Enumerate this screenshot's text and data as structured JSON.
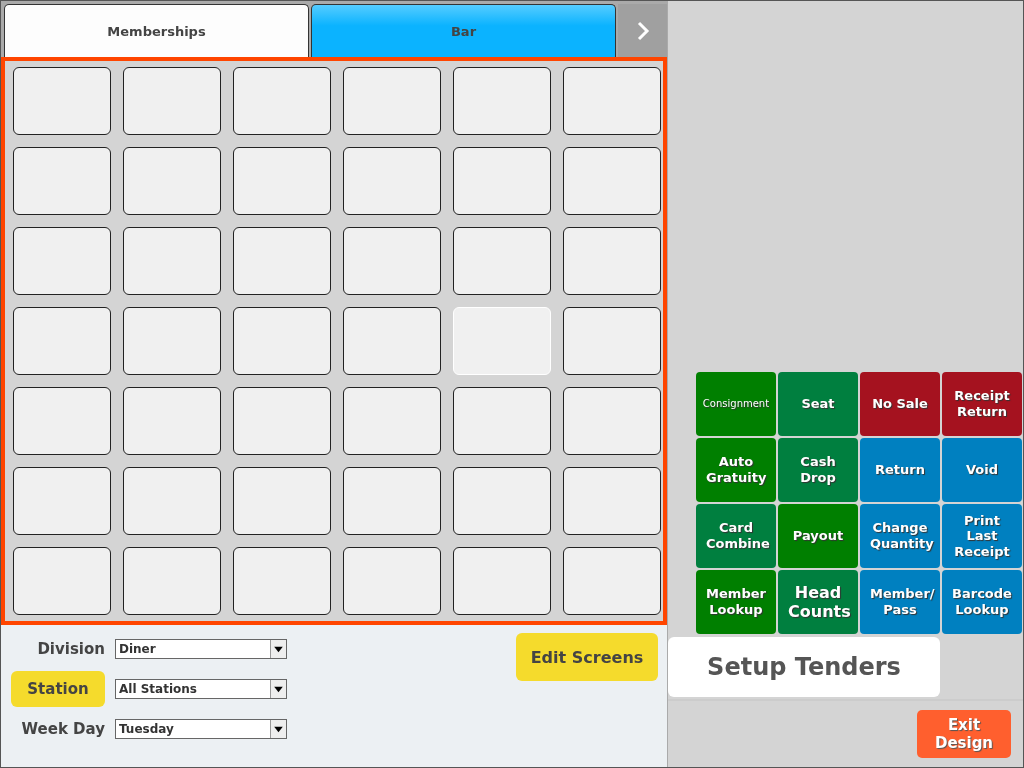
{
  "tabs": [
    {
      "label": "Memberships",
      "selected": false
    },
    {
      "label": "Bar",
      "selected": true
    }
  ],
  "slots": [
    {
      "selected": false
    },
    {
      "selected": false
    },
    {
      "selected": false
    },
    {
      "selected": false
    },
    {
      "selected": false
    },
    {
      "selected": false
    },
    {
      "selected": false
    },
    {
      "selected": false
    },
    {
      "selected": false
    },
    {
      "selected": false
    },
    {
      "selected": false
    },
    {
      "selected": false
    },
    {
      "selected": false
    },
    {
      "selected": false
    },
    {
      "selected": false
    },
    {
      "selected": false
    },
    {
      "selected": false
    },
    {
      "selected": false
    },
    {
      "selected": false
    },
    {
      "selected": false
    },
    {
      "selected": false
    },
    {
      "selected": false
    },
    {
      "selected": true
    },
    {
      "selected": false
    },
    {
      "selected": false
    },
    {
      "selected": false
    },
    {
      "selected": false
    },
    {
      "selected": false
    },
    {
      "selected": false
    },
    {
      "selected": false
    },
    {
      "selected": false
    },
    {
      "selected": false
    },
    {
      "selected": false
    },
    {
      "selected": false
    },
    {
      "selected": false
    },
    {
      "selected": false
    },
    {
      "selected": false
    },
    {
      "selected": false
    },
    {
      "selected": false
    },
    {
      "selected": false
    },
    {
      "selected": false
    },
    {
      "selected": false
    }
  ],
  "filters": [
    {
      "label": "Division",
      "highlighted": false,
      "value": "Diner"
    },
    {
      "label": "Station",
      "highlighted": true,
      "value": "All Stations"
    },
    {
      "label": "Week Day",
      "highlighted": false,
      "value": "Tuesday"
    }
  ],
  "edit_button": "Edit Screens",
  "tenders": [
    {
      "label": "Consignment",
      "color": "#007f00",
      "kind": "small"
    },
    {
      "label": "Seat",
      "color": "#007f3f",
      "kind": "normal"
    },
    {
      "label": "No Sale",
      "color": "#a5121f",
      "kind": "normal"
    },
    {
      "label": "Receipt Return",
      "color": "#a5121f",
      "kind": "normal"
    },
    {
      "label": "Auto Gratuity",
      "color": "#007f00",
      "kind": "normal"
    },
    {
      "label": "Cash Drop",
      "color": "#007f3f",
      "kind": "normal"
    },
    {
      "label": "Return",
      "color": "#0080c0",
      "kind": "normal"
    },
    {
      "label": "Void",
      "color": "#0080c0",
      "kind": "normal"
    },
    {
      "label": "Card Combine",
      "color": "#007f3f",
      "kind": "normal"
    },
    {
      "label": "Payout",
      "color": "#007f00",
      "kind": "normal"
    },
    {
      "label": "Change Quantity",
      "color": "#0080c0",
      "kind": "normal"
    },
    {
      "label": "Print Last Receipt",
      "color": "#0080c0",
      "kind": "normal"
    },
    {
      "label": "Member Lookup",
      "color": "#007f00",
      "kind": "normal"
    },
    {
      "label": "Head Counts",
      "color": "#007f3f",
      "kind": "large"
    },
    {
      "label": "Member/ Pass",
      "color": "#0080c0",
      "kind": "normal"
    },
    {
      "label": "Barcode Lookup",
      "color": "#0080c0",
      "kind": "normal"
    }
  ],
  "setup_button": "Setup Tenders",
  "exit_button": "Exit Design"
}
